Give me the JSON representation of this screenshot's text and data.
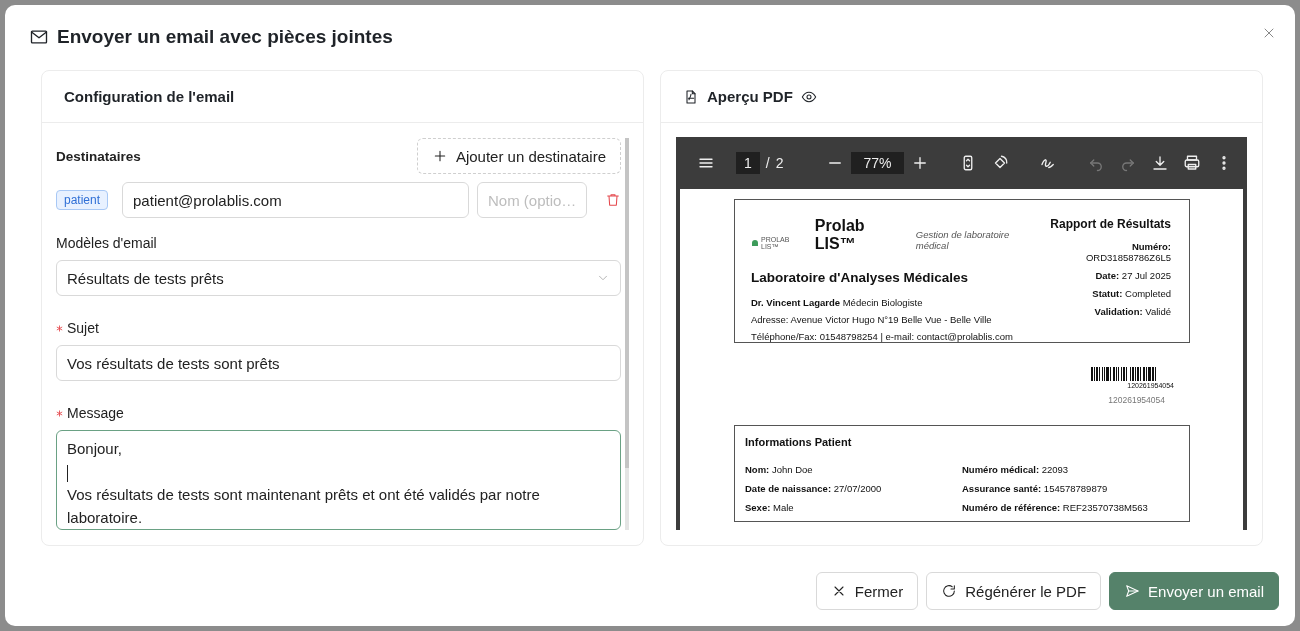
{
  "dialog": {
    "title": "Envoyer un email avec pièces jointes"
  },
  "config": {
    "title": "Configuration de l'email",
    "recipients_label": "Destinataires",
    "add_recipient_button": "Ajouter un destinataire",
    "recipients": [
      {
        "tag": "patient",
        "email": "patient@prolablis.com",
        "name_placeholder": "Nom (optio…"
      }
    ],
    "template": {
      "label": "Modèles d'email",
      "value": "Résultats de tests prêts"
    },
    "subject": {
      "label": "Sujet",
      "required": true,
      "value": "Vos résultats de tests sont prêts"
    },
    "message": {
      "label": "Message",
      "required": true,
      "focused": true,
      "paragraphs": [
        "Bonjour,",
        "Vos résultats de tests sont maintenant prêts et ont été validés par notre laboratoire."
      ]
    }
  },
  "preview": {
    "title": "Aperçu PDF",
    "toolbar": {
      "page": "1",
      "page_separator": "/",
      "page_count": "2",
      "zoom": "77%",
      "undo": {
        "disabled": true
      },
      "redo": {
        "disabled": true
      }
    },
    "document": {
      "logo_text": "PROLAB LIS™",
      "brand": "Prolab LIS™",
      "tagline": "Gestion de laboratoire médical",
      "lab_name": "Laboratoire d'Analyses Médicales",
      "doctor": "**Dr. Vincent Lagarde** Médecin Biologiste",
      "address": "Adresse: Avenue Victor Hugo N°19 Belle Vue - Belle Ville",
      "contact": "Téléphone/Fax: 01548798254 | e-mail: contact@prolablis.com",
      "report_title": "Rapport de Résultats",
      "report_fields": [
        {
          "label": "Numéro:",
          "value": "ORD31858786Z6L5"
        },
        {
          "label": "Date:",
          "value": "27 Jul 2025"
        },
        {
          "label": "Statut:",
          "value": "Completed"
        },
        {
          "label": "Validation:",
          "value": "Validé"
        }
      ],
      "barcode_caption": "120261954054",
      "barcode_number": "120261954054",
      "patient_title": "Informations Patient",
      "patient_left": [
        {
          "label": "Nom:",
          "value": "John Doe"
        },
        {
          "label": "Date de naissance:",
          "value": "27/07/2000"
        },
        {
          "label": "Sexe:",
          "value": "Male"
        }
      ],
      "patient_right": [
        {
          "label": "Numéro médical:",
          "value": "22093"
        },
        {
          "label": "Assurance santé:",
          "value": "154578789879"
        },
        {
          "label": "Numéro de référence:",
          "value": "REF23570738M563"
        }
      ]
    }
  },
  "footer_buttons": [
    {
      "kind": "close",
      "label": "Fermer"
    },
    {
      "kind": "regenerate",
      "label": "Régénérer le PDF"
    },
    {
      "kind": "send",
      "label": "Envoyer un email"
    }
  ]
}
